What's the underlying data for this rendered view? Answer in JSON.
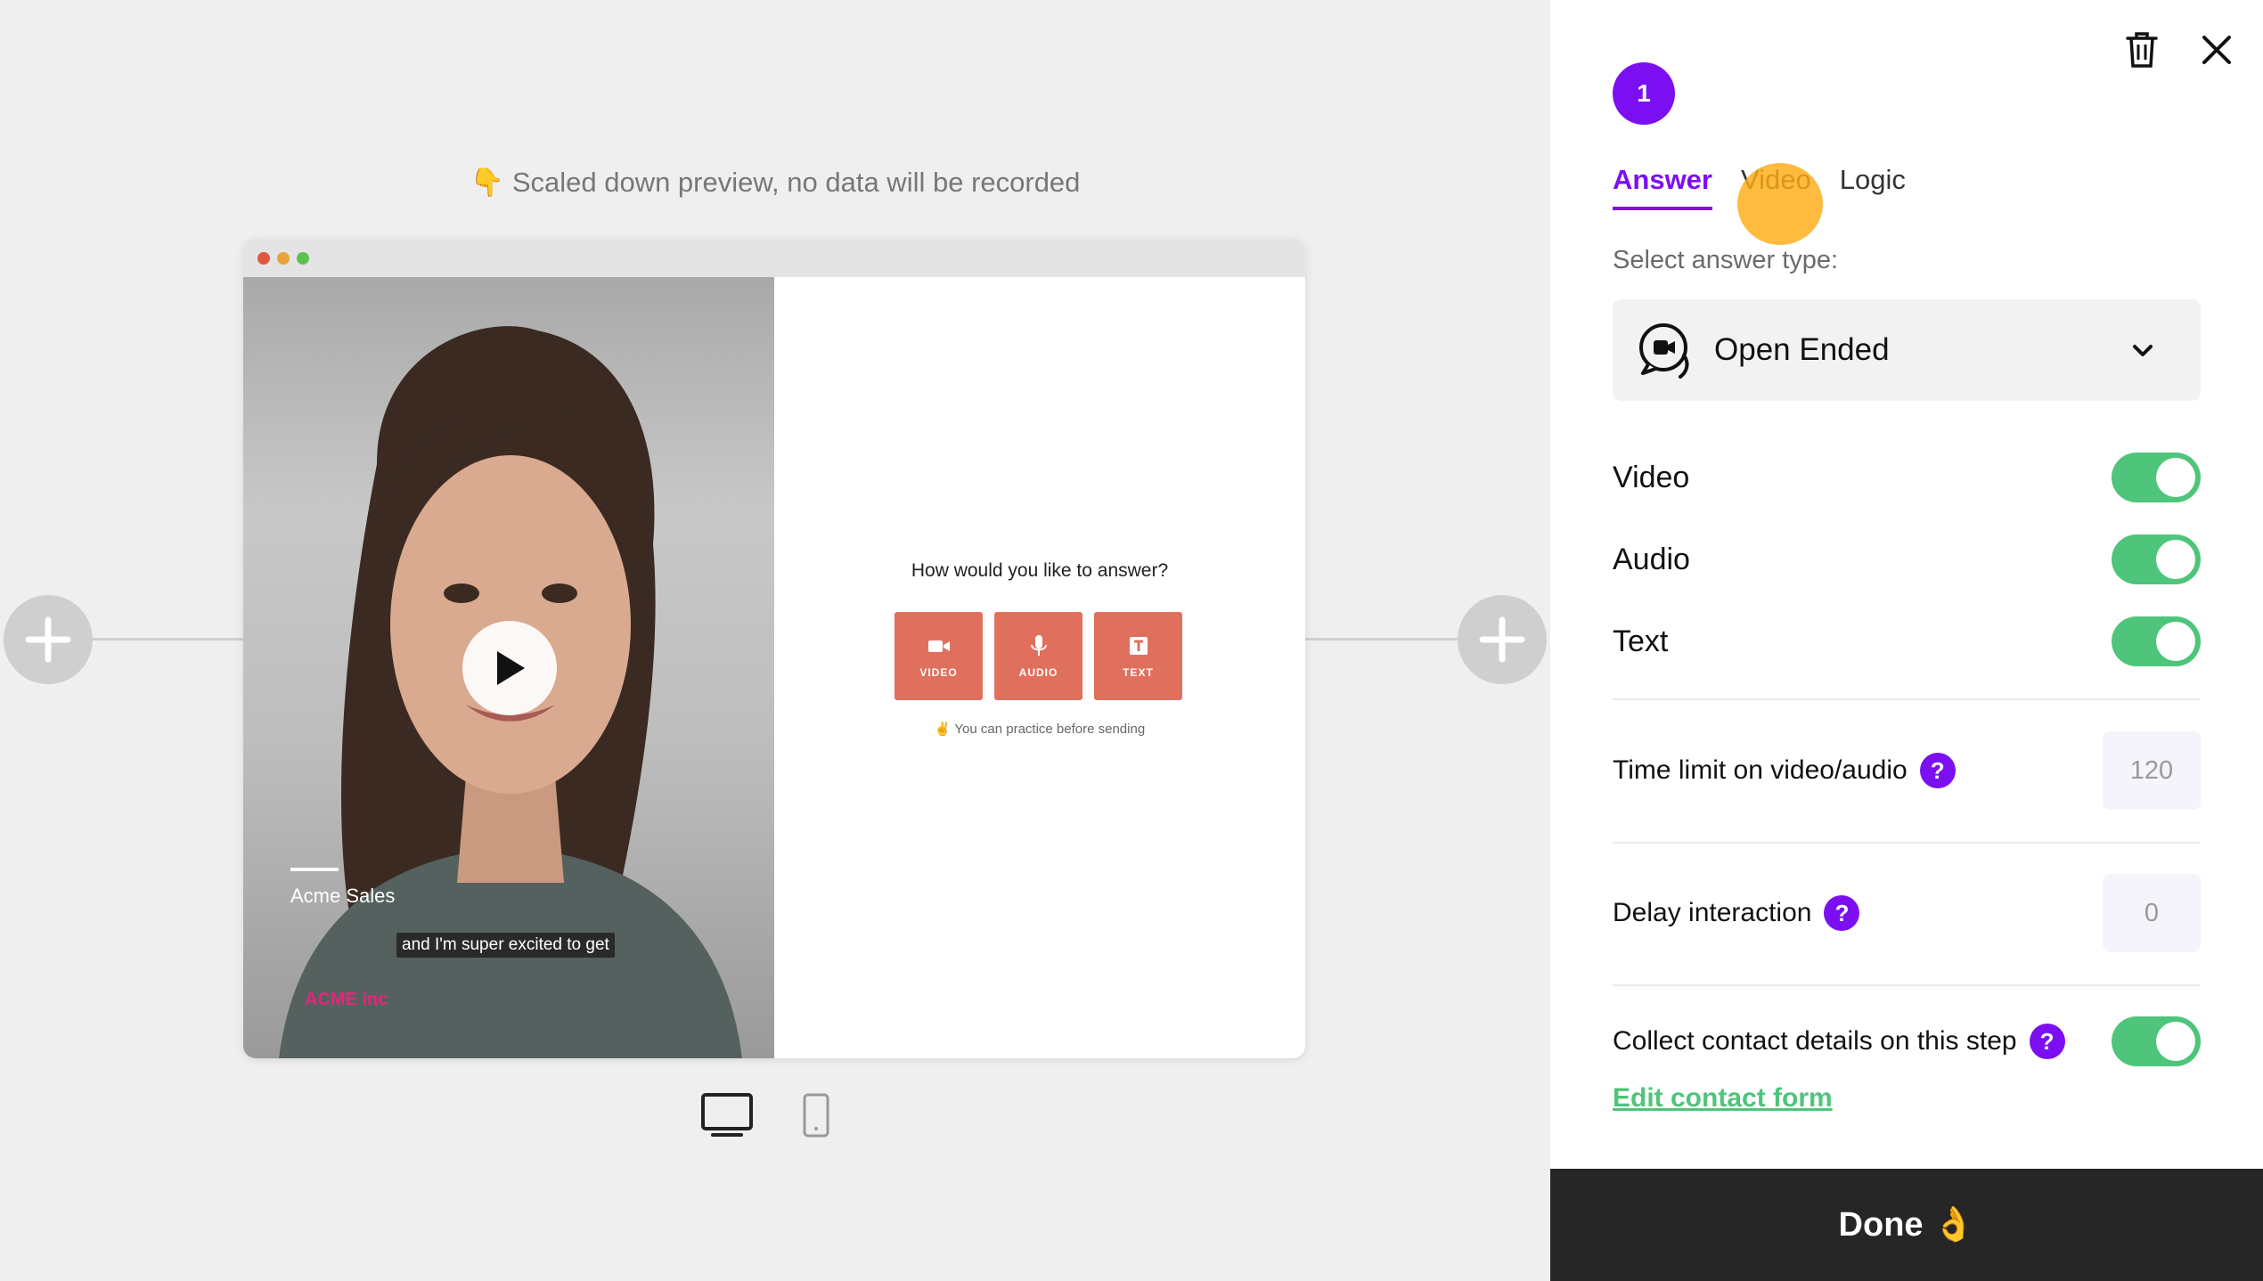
{
  "preview": {
    "note_icon": "👇",
    "note": "Scaled down preview, no data will be recorded"
  },
  "video": {
    "presenter_name": "Acme Sales",
    "caption": "and I'm super excited to get",
    "brand": "ACME inc"
  },
  "answer_prompt": {
    "question": "How would you like to answer?",
    "buttons": [
      {
        "label": "VIDEO",
        "icon": "video-camera-icon"
      },
      {
        "label": "AUDIO",
        "icon": "microphone-icon"
      },
      {
        "label": "TEXT",
        "icon": "text-icon"
      }
    ],
    "practice_icon": "✌",
    "practice_note": "You can practice before sending"
  },
  "device_toggle": {
    "options": [
      "desktop-icon",
      "mobile-icon"
    ],
    "selected": "desktop"
  },
  "panel": {
    "step_number": "1",
    "tabs": [
      {
        "label": "Answer",
        "active": true
      },
      {
        "label": "Video",
        "active": false
      },
      {
        "label": "Logic",
        "active": false
      }
    ],
    "answer_type_label": "Select answer type:",
    "answer_type_value": "Open Ended",
    "toggles": [
      {
        "label": "Video",
        "on": true
      },
      {
        "label": "Audio",
        "on": true
      },
      {
        "label": "Text",
        "on": true
      }
    ],
    "time_limit": {
      "label": "Time limit on video/audio",
      "value": "120"
    },
    "delay": {
      "label": "Delay interaction",
      "value": "0"
    },
    "contact": {
      "label": "Collect contact details on this step",
      "on": true,
      "link": "Edit contact form"
    },
    "done_label": "Done",
    "done_emoji": "👌"
  },
  "colors": {
    "accent": "#7b0ff2",
    "toggle_on": "#4ec57a",
    "answer_button": "#e0705e",
    "done_bg": "#262626"
  }
}
